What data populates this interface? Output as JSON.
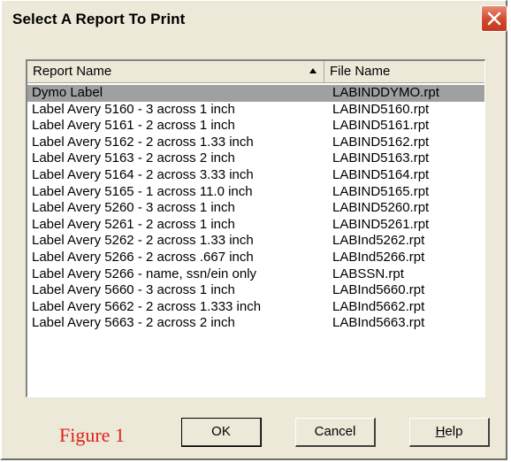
{
  "dialog": {
    "title": "Select A Report To Print",
    "close_icon": "close-icon"
  },
  "list": {
    "columns": [
      {
        "label": "Report Name",
        "sorted": "ascending"
      },
      {
        "label": "File Name"
      }
    ],
    "selected_index": 0,
    "rows": [
      {
        "name": "Dymo Label",
        "file": "LABINDDYMO.rpt"
      },
      {
        "name": "Label Avery 5160 - 3 across 1 inch",
        "file": "LABIND5160.rpt"
      },
      {
        "name": "Label Avery 5161 - 2 across 1 inch",
        "file": "LABIND5161.rpt"
      },
      {
        "name": "Label Avery 5162 - 2 across 1.33 inch",
        "file": "LABIND5162.rpt"
      },
      {
        "name": "Label Avery 5163 - 2 across 2 inch",
        "file": "LABIND5163.rpt"
      },
      {
        "name": "Label Avery 5164 - 2 across 3.33 inch",
        "file": "LABIND5164.rpt"
      },
      {
        "name": "Label Avery 5165 - 1 across 11.0 inch",
        "file": "LABIND5165.rpt"
      },
      {
        "name": "Label Avery 5260 - 3 across 1 inch",
        "file": "LABIND5260.rpt"
      },
      {
        "name": "Label Avery 5261 - 2 across 1 inch",
        "file": "LABIND5261.rpt"
      },
      {
        "name": "Label Avery 5262 - 2 across 1.33 inch",
        "file": "LABInd5262.rpt"
      },
      {
        "name": "Label Avery 5266 - 2 across .667 inch",
        "file": "LABInd5266.rpt"
      },
      {
        "name": "Label Avery 5266 - name, ssn/ein only",
        "file": "LABSSN.rpt"
      },
      {
        "name": "Label Avery 5660 - 3 across 1 inch",
        "file": "LABInd5660.rpt"
      },
      {
        "name": "Label Avery 5662 - 2 across 1.333 inch",
        "file": "LABInd5662.rpt"
      },
      {
        "name": "Label Avery 5663 - 2 across 2 inch",
        "file": "LABInd5663.rpt"
      }
    ]
  },
  "footer": {
    "figure_label": "Figure 1",
    "ok_label": "OK",
    "cancel_label": "Cancel",
    "help_label": "Help"
  },
  "colors": {
    "dialog_bg": "#ece9d8",
    "selected_row": "#a0a0a0",
    "figure_label": "#e0201c",
    "close_button": "#d2492b"
  }
}
